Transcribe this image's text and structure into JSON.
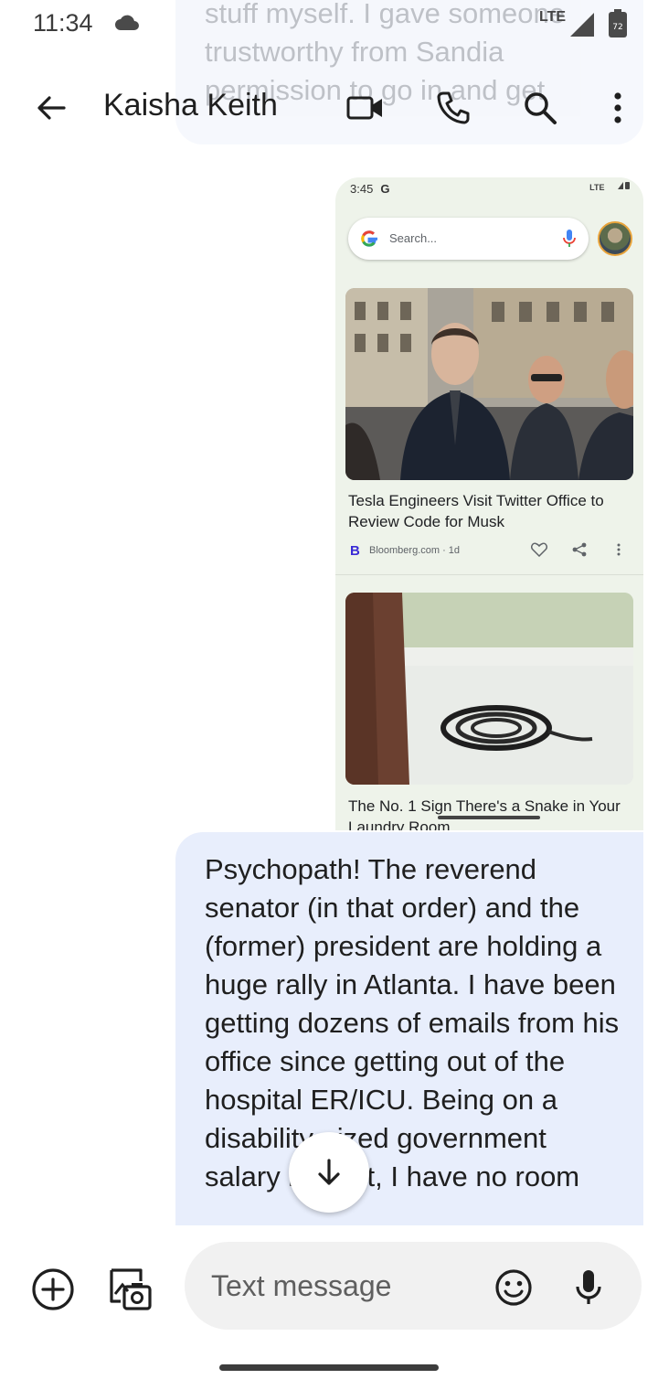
{
  "status_bar": {
    "time": "11:34",
    "network": "LTE",
    "battery_level": "72",
    "icons": [
      "cloud-icon",
      "signal-icon",
      "battery-icon"
    ]
  },
  "previous_message": {
    "text": "stuff myself. I gave someone trustworthy from Sandia permission to go in and get"
  },
  "header": {
    "contact_name": "Kaisha Keith",
    "icons": [
      "back-arrow-icon",
      "video-call-icon",
      "phone-icon",
      "search-icon",
      "more-vert-icon"
    ]
  },
  "attachment": {
    "status_time": "3:45",
    "status_g": "G",
    "status_right": "LTE",
    "search_placeholder": "Search...",
    "article_1_title": "Tesla Engineers Visit Twitter Office to Review Code for Musk",
    "source_logo": "B",
    "article_1_source": "Bloomberg.com · 1d",
    "article_2_title": "The No. 1 Sign There's a Snake in Your Laundry Room"
  },
  "message": {
    "text": "Psychopath! The reverend senator (in that order) and the (former) president are holding a huge rally in Atlanta. I have been getting dozens of emails from his office since getting out of the hospital ER/ICU. Being on a disability-sized government salary budget, I have no room"
  },
  "composer": {
    "placeholder": "Text message",
    "icons": [
      "add-circle-icon",
      "gallery-camera-icon",
      "emoji-icon",
      "mic-icon"
    ]
  },
  "colors": {
    "bubble": "#e8eefc",
    "composer_field": "#f1f1f1",
    "attachment_bg": "#eef3ea",
    "source_logo": "#3a2bd6"
  }
}
